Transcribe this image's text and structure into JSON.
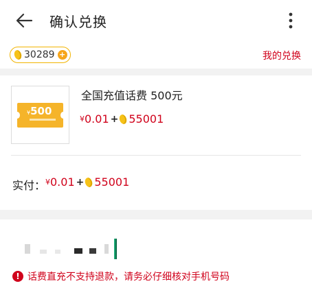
{
  "header": {
    "title": "确认兑换",
    "back_icon": "arrow-left-icon",
    "menu_icon": "more-vertical-icon"
  },
  "points_bar": {
    "balance": "30289",
    "add_icon": "plus-circle-icon",
    "my_exchange_label": "我的兑换"
  },
  "product": {
    "name": "全国充值话费 500元",
    "thumbnail": {
      "amount": "500",
      "currency_symbol": "¥"
    },
    "price": {
      "currency_symbol": "¥",
      "cash": "0.01",
      "plus": "+",
      "points": "55001"
    }
  },
  "actual_payment": {
    "label": "实付：",
    "currency_symbol": "¥",
    "cash": "0.01",
    "plus": "+",
    "points": "55001"
  },
  "phone_section": {
    "warning_icon": "alert-circle-icon",
    "warning_text": "话费直充不支持退款，请务必仔细核对手机号码"
  },
  "colors": {
    "accent_red": "#d0021b",
    "bean_yellow": "#f6c218",
    "points_border": "#f2b400"
  }
}
